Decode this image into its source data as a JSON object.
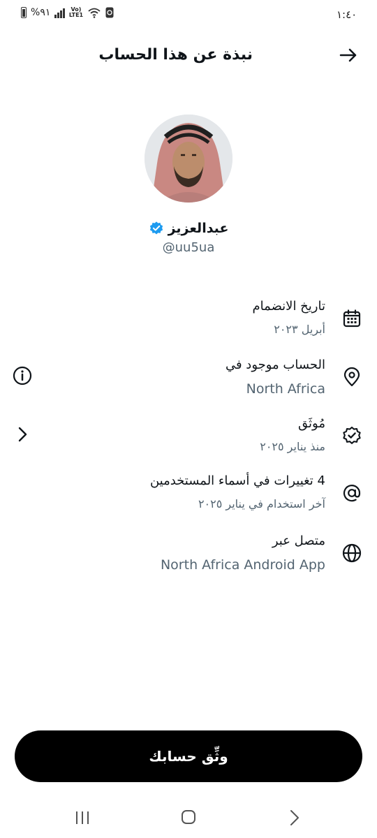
{
  "status_bar": {
    "time": "١:٤٠",
    "battery": "%٩١",
    "network": "Vo)) LTE1"
  },
  "header": {
    "title": "نبذة عن هذا الحساب"
  },
  "profile": {
    "name": "عبدالعزيز",
    "handle": "@uu5ua",
    "verified": true,
    "accent_color": "#1d9bf0"
  },
  "details": [
    {
      "icon": "calendar-icon",
      "title": "تاريخ الانضمام",
      "subtitle": "أبريل ٢٠٢٣"
    },
    {
      "icon": "location-pin-icon",
      "title": "الحساب موجود في",
      "subtitle": "North Africa",
      "side_icon": "info-icon"
    },
    {
      "icon": "verified-check-icon",
      "title": "مُوثَق",
      "subtitle": "منذ يناير ٢٠٢٥",
      "side_icon": "chevron-right-icon"
    },
    {
      "icon": "at-sign-icon",
      "title": "4 تغييرات في أسماء المستخدمين",
      "subtitle": "آخر استخدام في يناير ٢٠٢٥"
    },
    {
      "icon": "globe-icon",
      "title": "متصل عبر",
      "subtitle": "North Africa Android App"
    }
  ],
  "cta": {
    "label": "وثِّق حسابك"
  },
  "nav_bar": {
    "icons": [
      "recents-icon",
      "home-icon",
      "back-chevron-icon"
    ]
  }
}
